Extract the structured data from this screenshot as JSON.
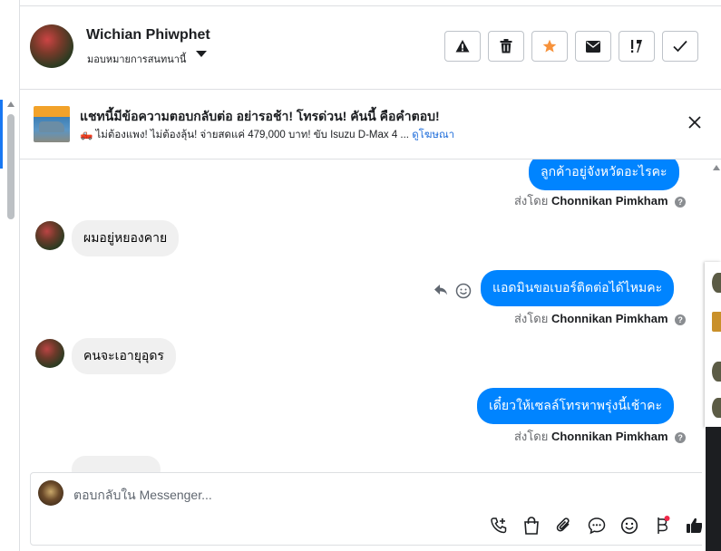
{
  "header": {
    "contact_name": "Wichian Phiwphet",
    "assign_label": "มอบหมายการสนทนานี้",
    "actions": [
      {
        "name": "report-spam-button",
        "icon": "warning-icon"
      },
      {
        "name": "delete-button",
        "icon": "trash-icon"
      },
      {
        "name": "star-button",
        "icon": "star-icon",
        "color": "#f7923b"
      },
      {
        "name": "mark-unread-button",
        "icon": "envelope-icon"
      },
      {
        "name": "follow-up-button",
        "icon": "exclamation-icon"
      },
      {
        "name": "mark-done-button",
        "icon": "check-icon"
      }
    ]
  },
  "ad_banner": {
    "title": "แชทนี้มีข้อความตอบกลับต่อ อย่ารอช้า! โทรด่วน! คันนี้ คือคำตอบ!",
    "subtitle": "🛻 ไม่ต้องแพง! ไม่ต้องลุ้น! จ่ายสดแค่ 479,000 บาท! ขับ Isuzu D-Max 4 ...",
    "link": "ดูโฆษณา"
  },
  "messages": [
    {
      "direction": "out",
      "text": "ลูกค้าอยู่จังหวัดอะไรคะ",
      "sent_by_prefix": "ส่งโดย",
      "sent_by_name": "Chonnikan Pimkham"
    },
    {
      "direction": "in",
      "text": "ผมอยู่หยองคาย"
    },
    {
      "direction": "out",
      "text": "แอดมินขอเบอร์ติดต่อได้ไหมคะ",
      "sent_by_prefix": "ส่งโดย",
      "sent_by_name": "Chonnikan Pimkham"
    },
    {
      "direction": "in",
      "text": "คนจะเอายุอุดร"
    },
    {
      "direction": "out",
      "text": "เดี๋ยวให้เซลล์โทรหาพรุ่งนี้เช้าคะ",
      "sent_by_prefix": "ส่งโดย",
      "sent_by_name": "Chonnikan Pimkham"
    }
  ],
  "composer": {
    "placeholder": "ตอบกลับใน Messenger...",
    "tools": [
      "call-add-icon",
      "shopping-bag-icon",
      "paperclip-icon",
      "saved-reply-icon",
      "emoji-icon",
      "baht-payment-icon",
      "thumbs-up-icon"
    ]
  },
  "colors": {
    "accent": "#0084ff",
    "star": "#f7923b",
    "link": "#216fdb"
  }
}
